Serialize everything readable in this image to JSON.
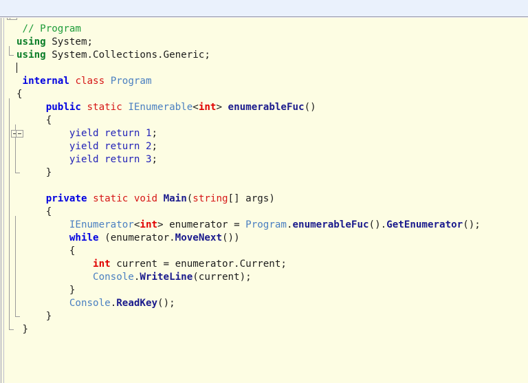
{
  "window": {
    "title_bar_color": "#eaf1fc",
    "editor_background": "#fdfde3"
  },
  "theme": {
    "comment_color": "#1f9c3a",
    "using_keyword_color": "#0a7d28",
    "keyword_color": "#0000e0",
    "modifier_keyword_color": "#d61616",
    "type_color": "#4a7fc1",
    "builtin_type_color": "#e00000",
    "method_color": "#1a1a8c",
    "number_color": "#2323b8",
    "plain_text_color": "#1c1c1c",
    "fold_marker_color": "#9a9a9a"
  },
  "editor": {
    "language": "C#",
    "caret_line": 4,
    "fold_markers": [
      {
        "line": 2,
        "state": "expanded",
        "symbol": "minus"
      },
      {
        "line": 6,
        "state": "expanded",
        "symbol": "minus"
      },
      {
        "line": 8,
        "state": "expanded",
        "symbol": "minus"
      },
      {
        "line": 14,
        "state": "expanded",
        "symbol": "minus"
      }
    ],
    "lines": [
      {
        "n": 1,
        "indent": 1,
        "tokens": [
          {
            "t": "comment",
            "v": "// Program"
          }
        ]
      },
      {
        "n": 2,
        "indent": 0,
        "tokens": [
          {
            "t": "using",
            "v": "using"
          },
          {
            "t": "plain",
            "v": " System;"
          }
        ]
      },
      {
        "n": 3,
        "indent": 0,
        "tokens": [
          {
            "t": "using",
            "v": "using"
          },
          {
            "t": "plain",
            "v": " System.Collections.Generic;"
          }
        ]
      },
      {
        "n": 4,
        "indent": 0,
        "tokens": [
          {
            "t": "caret",
            "v": ""
          }
        ]
      },
      {
        "n": 5,
        "indent": 1,
        "tokens": [
          {
            "t": "kw",
            "v": "internal"
          },
          {
            "t": "plain",
            "v": " "
          },
          {
            "t": "kw2",
            "v": "class"
          },
          {
            "t": "plain",
            "v": " "
          },
          {
            "t": "type",
            "v": "Program"
          }
        ]
      },
      {
        "n": 6,
        "indent": 0,
        "tokens": [
          {
            "t": "plain",
            "v": "{"
          }
        ]
      },
      {
        "n": 7,
        "indent": 1,
        "tokens": [
          {
            "t": "plain",
            "v": "    "
          },
          {
            "t": "kw",
            "v": "public"
          },
          {
            "t": "plain",
            "v": " "
          },
          {
            "t": "kw2",
            "v": "static"
          },
          {
            "t": "plain",
            "v": " "
          },
          {
            "t": "type",
            "v": "IEnumerable"
          },
          {
            "t": "plain",
            "v": "<"
          },
          {
            "t": "int",
            "v": "int"
          },
          {
            "t": "plain",
            "v": "> "
          },
          {
            "t": "method",
            "v": "enumerableFuc"
          },
          {
            "t": "plain",
            "v": "()"
          }
        ]
      },
      {
        "n": 8,
        "indent": 1,
        "tokens": [
          {
            "t": "plain",
            "v": "    {"
          }
        ]
      },
      {
        "n": 9,
        "indent": 1,
        "tokens": [
          {
            "t": "plain",
            "v": "        "
          },
          {
            "t": "yield",
            "v": "yield return"
          },
          {
            "t": "plain",
            "v": " "
          },
          {
            "t": "num",
            "v": "1"
          },
          {
            "t": "plain",
            "v": ";"
          }
        ]
      },
      {
        "n": 10,
        "indent": 1,
        "tokens": [
          {
            "t": "plain",
            "v": "        "
          },
          {
            "t": "yield",
            "v": "yield return"
          },
          {
            "t": "plain",
            "v": " "
          },
          {
            "t": "num",
            "v": "2"
          },
          {
            "t": "plain",
            "v": ";"
          }
        ]
      },
      {
        "n": 11,
        "indent": 1,
        "tokens": [
          {
            "t": "plain",
            "v": "        "
          },
          {
            "t": "yield",
            "v": "yield return"
          },
          {
            "t": "plain",
            "v": " "
          },
          {
            "t": "num",
            "v": "3"
          },
          {
            "t": "plain",
            "v": ";"
          }
        ]
      },
      {
        "n": 12,
        "indent": 1,
        "tokens": [
          {
            "t": "plain",
            "v": "    }"
          }
        ]
      },
      {
        "n": 13,
        "indent": 1,
        "tokens": []
      },
      {
        "n": 14,
        "indent": 1,
        "tokens": [
          {
            "t": "plain",
            "v": "    "
          },
          {
            "t": "kw",
            "v": "private"
          },
          {
            "t": "plain",
            "v": " "
          },
          {
            "t": "kw2",
            "v": "static"
          },
          {
            "t": "plain",
            "v": " "
          },
          {
            "t": "kw2",
            "v": "void"
          },
          {
            "t": "plain",
            "v": " "
          },
          {
            "t": "method",
            "v": "Main"
          },
          {
            "t": "plain",
            "v": "("
          },
          {
            "t": "kw2",
            "v": "string"
          },
          {
            "t": "plain",
            "v": "[] args)"
          }
        ]
      },
      {
        "n": 15,
        "indent": 1,
        "tokens": [
          {
            "t": "plain",
            "v": "    {"
          }
        ]
      },
      {
        "n": 16,
        "indent": 1,
        "tokens": [
          {
            "t": "plain",
            "v": "        "
          },
          {
            "t": "type",
            "v": "IEnumerator"
          },
          {
            "t": "plain",
            "v": "<"
          },
          {
            "t": "int",
            "v": "int"
          },
          {
            "t": "plain",
            "v": "> enumerator = "
          },
          {
            "t": "type",
            "v": "Program"
          },
          {
            "t": "plain",
            "v": "."
          },
          {
            "t": "method",
            "v": "enumerableFuc"
          },
          {
            "t": "plain",
            "v": "()."
          },
          {
            "t": "method",
            "v": "GetEnumerator"
          },
          {
            "t": "plain",
            "v": "();"
          }
        ]
      },
      {
        "n": 17,
        "indent": 1,
        "tokens": [
          {
            "t": "plain",
            "v": "        "
          },
          {
            "t": "kw",
            "v": "while"
          },
          {
            "t": "plain",
            "v": " (enumerator."
          },
          {
            "t": "method",
            "v": "MoveNext"
          },
          {
            "t": "plain",
            "v": "())"
          }
        ]
      },
      {
        "n": 18,
        "indent": 1,
        "tokens": [
          {
            "t": "plain",
            "v": "        {"
          }
        ]
      },
      {
        "n": 19,
        "indent": 1,
        "tokens": [
          {
            "t": "plain",
            "v": "            "
          },
          {
            "t": "int",
            "v": "int"
          },
          {
            "t": "plain",
            "v": " current = enumerator.Current;"
          }
        ]
      },
      {
        "n": 20,
        "indent": 1,
        "tokens": [
          {
            "t": "plain",
            "v": "            "
          },
          {
            "t": "type",
            "v": "Console"
          },
          {
            "t": "plain",
            "v": "."
          },
          {
            "t": "method",
            "v": "WriteLine"
          },
          {
            "t": "plain",
            "v": "(current);"
          }
        ]
      },
      {
        "n": 21,
        "indent": 1,
        "tokens": [
          {
            "t": "plain",
            "v": "        }"
          }
        ]
      },
      {
        "n": 22,
        "indent": 1,
        "tokens": [
          {
            "t": "plain",
            "v": "        "
          },
          {
            "t": "type",
            "v": "Console"
          },
          {
            "t": "plain",
            "v": "."
          },
          {
            "t": "method",
            "v": "ReadKey"
          },
          {
            "t": "plain",
            "v": "();"
          }
        ]
      },
      {
        "n": 23,
        "indent": 1,
        "tokens": [
          {
            "t": "plain",
            "v": "    }"
          }
        ]
      },
      {
        "n": 24,
        "indent": 1,
        "tokens": [
          {
            "t": "plain",
            "v": "}"
          }
        ]
      }
    ]
  }
}
